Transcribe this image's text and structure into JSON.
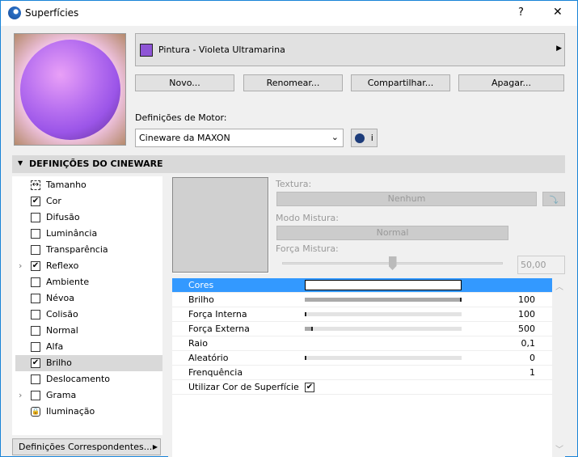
{
  "window": {
    "title": "Superfícies",
    "help": "?",
    "close": "✕"
  },
  "surface": {
    "name": "Pintura - Violeta Ultramarina",
    "swatch": "#8e55d6"
  },
  "buttons": {
    "new": "Novo...",
    "rename": "Renomear...",
    "share": "Compartilhar...",
    "delete": "Apagar..."
  },
  "engine": {
    "label": "Definições de Motor:",
    "value": "Cineware da MAXON",
    "info": "i"
  },
  "section": {
    "title": "DEFINIÇÕES DO CINEWARE"
  },
  "channels": [
    {
      "label": "Tamanho",
      "type": "icon"
    },
    {
      "label": "Cor",
      "checked": true
    },
    {
      "label": "Difusão",
      "checked": false
    },
    {
      "label": "Luminância",
      "checked": false
    },
    {
      "label": "Transparência",
      "checked": false
    },
    {
      "label": "Reflexo",
      "checked": true,
      "expandable": true
    },
    {
      "label": "Ambiente",
      "checked": false
    },
    {
      "label": "Névoa",
      "checked": false
    },
    {
      "label": "Colisão",
      "checked": false
    },
    {
      "label": "Normal",
      "checked": false
    },
    {
      "label": "Alfa",
      "checked": false
    },
    {
      "label": "Brilho",
      "checked": true,
      "selected": true
    },
    {
      "label": "Deslocamento",
      "checked": false
    },
    {
      "label": "Grama",
      "checked": false,
      "expandable": true
    },
    {
      "label": "Iluminação",
      "type": "lock"
    }
  ],
  "matching_button": "Definições Correspondentes...",
  "texture": {
    "label": "Textura:",
    "value": "Nenhum",
    "mix_mode_label": "Modo Mistura:",
    "mix_mode": "Normal",
    "mix_strength_label": "Força Mistura:",
    "mix_strength": "50,00",
    "mix_strength_fraction": 0.5
  },
  "params": [
    {
      "name": "Cores",
      "type": "color",
      "selected": true
    },
    {
      "name": "Brilho",
      "value": "100",
      "fill": 1.0
    },
    {
      "name": "Força Interna",
      "value": "100",
      "fill": 0.0
    },
    {
      "name": "Força Externa",
      "value": "500",
      "fill": 0.05
    },
    {
      "name": "Raio",
      "value": "0,1"
    },
    {
      "name": "Aleatório",
      "value": "0",
      "fill": 0.0
    },
    {
      "name": "Frenquência",
      "value": "1"
    },
    {
      "name": "Utilizar Cor de Superfície",
      "type": "checkbox",
      "checked": true
    }
  ]
}
